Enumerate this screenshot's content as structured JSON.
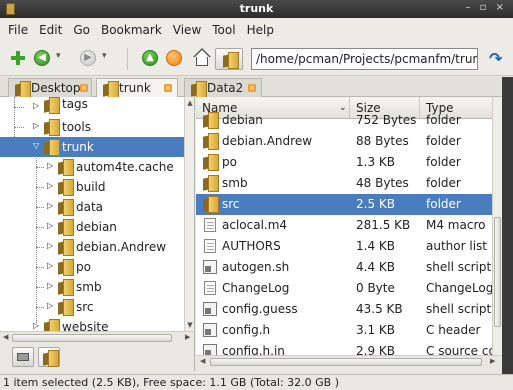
{
  "window": {
    "title": "trunk",
    "controls": "– ▫ ×"
  },
  "menu": [
    "File",
    "Edit",
    "Go",
    "Bookmark",
    "View",
    "Tool",
    "Help"
  ],
  "toolbar": {
    "location": "/home/pcman/Projects/pcmanfm/trunk",
    "dropdown_glyph": "▾",
    "go_glyph": "↷",
    "up_glyph": "▲",
    "back_glyph": "◀",
    "forward_glyph": "▶"
  },
  "tabs": [
    {
      "label": "Desktop",
      "active": false
    },
    {
      "label": "trunk",
      "active": true
    },
    {
      "label": "Data2",
      "active": false
    }
  ],
  "tree": {
    "items": [
      {
        "label": "tags",
        "expander": "▷"
      },
      {
        "label": "tools",
        "expander": "▷"
      },
      {
        "label": "trunk",
        "expander": "▽",
        "selected": true
      },
      {
        "label": "autom4te.cache",
        "expander": "▷"
      },
      {
        "label": "build",
        "expander": "▷"
      },
      {
        "label": "data",
        "expander": "▷"
      },
      {
        "label": "debian",
        "expander": "▷"
      },
      {
        "label": "debian.Andrew",
        "expander": "▷"
      },
      {
        "label": "po",
        "expander": "▷"
      },
      {
        "label": "smb",
        "expander": "▷"
      },
      {
        "label": "src",
        "expander": "▷"
      },
      {
        "label": "website",
        "expander": "▷"
      }
    ]
  },
  "columns": {
    "name": "Name",
    "size": "Size",
    "type": "Type",
    "sort_glyph": "⌄"
  },
  "files": [
    {
      "name": "debian",
      "size": "752 Bytes",
      "type": "folder",
      "icon": "folder-icon"
    },
    {
      "name": "debian.Andrew",
      "size": "88 Bytes",
      "type": "folder",
      "icon": "folder-icon"
    },
    {
      "name": "po",
      "size": "1.3 KB",
      "type": "folder",
      "icon": "folder-icon"
    },
    {
      "name": "smb",
      "size": "48 Bytes",
      "type": "folder",
      "icon": "folder-icon"
    },
    {
      "name": "src",
      "size": "2.5 KB",
      "type": "folder",
      "icon": "folder-icon",
      "selected": true
    },
    {
      "name": "aclocal.m4",
      "size": "281.5 KB",
      "type": "M4 macro",
      "icon": "text-file-icon"
    },
    {
      "name": "AUTHORS",
      "size": "1.4 KB",
      "type": "author list",
      "icon": "text-file-icon"
    },
    {
      "name": "autogen.sh",
      "size": "4.4 KB",
      "type": "shell script",
      "icon": "script-file-icon"
    },
    {
      "name": "ChangeLog",
      "size": "0 Byte",
      "type": "ChangeLog document",
      "icon": "text-file-icon"
    },
    {
      "name": "config.guess",
      "size": "43.5 KB",
      "type": "shell script",
      "icon": "script-file-icon"
    },
    {
      "name": "config.h",
      "size": "3.1 KB",
      "type": "C header",
      "icon": "script-file-icon"
    },
    {
      "name": "config.h.in",
      "size": "2.9 KB",
      "type": "C source code",
      "icon": "script-file-icon"
    }
  ],
  "status": "1 item selected (2.5 KB), Free space: 1.1 GB (Total: 32.0 GB )",
  "colors": {
    "selection": "#4a7cc0",
    "folder": "#e8bd4e",
    "titlebar": "#333333"
  }
}
